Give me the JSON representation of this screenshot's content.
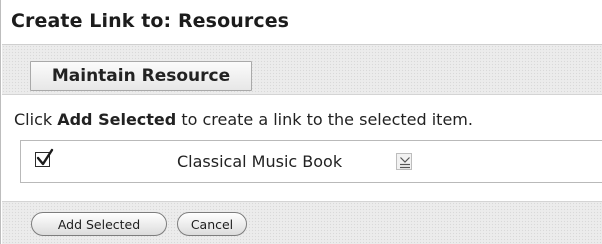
{
  "header": {
    "title": "Create Link to: Resources"
  },
  "toolbar": {
    "maintain_label": "Maintain Resource"
  },
  "instruction": {
    "prefix": "Click ",
    "emphasis": "Add Selected",
    "suffix": " to create a link to the selected item."
  },
  "items": [
    {
      "label": "Classical Music Book",
      "checked": true,
      "icon": "menu-icon"
    }
  ],
  "footer": {
    "add_label": "Add Selected",
    "cancel_label": "Cancel"
  }
}
